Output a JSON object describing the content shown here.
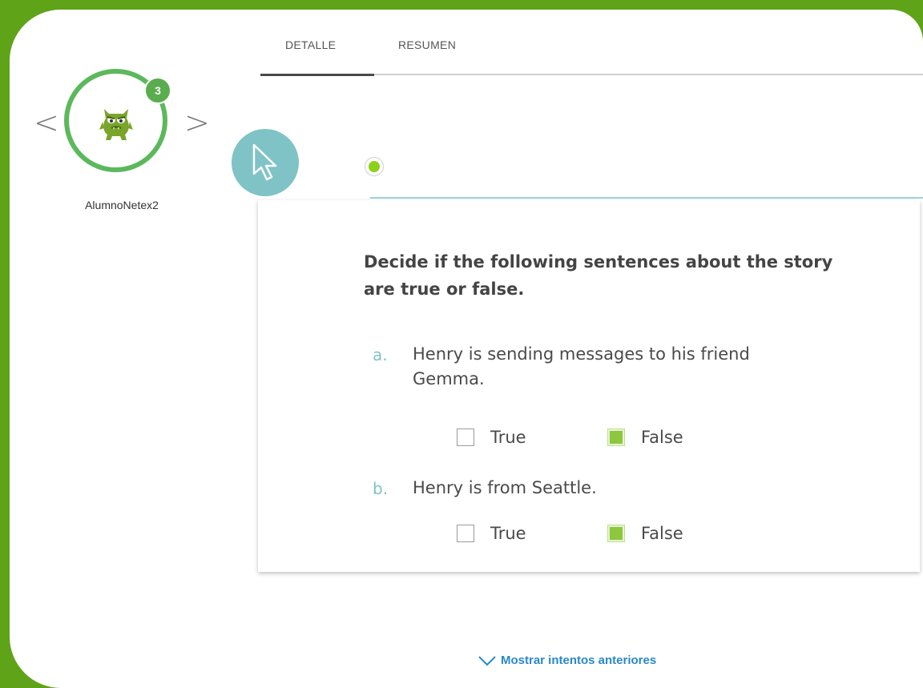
{
  "tabs": [
    {
      "label": "DETALLE",
      "active": true
    },
    {
      "label": "RESUMEN",
      "active": false
    }
  ],
  "student": {
    "name": "AlumnoNetex2",
    "attempt_badge": "3",
    "prev_icon": "chevron-left-icon",
    "next_icon": "chevron-right-icon",
    "avatar_icon": "monster-avatar-icon"
  },
  "activity": {
    "instruction": "Decide if the following sentences about the story are true or false.",
    "questions": [
      {
        "letter": "a.",
        "text": "Henry is sending messages to his friend Gemma.",
        "options": [
          {
            "label": "True",
            "checked": false
          },
          {
            "label": "False",
            "checked": true
          }
        ]
      },
      {
        "letter": "b.",
        "text": "Henry is from Seattle.",
        "options": [
          {
            "label": "True",
            "checked": false
          },
          {
            "label": "False",
            "checked": true
          }
        ]
      }
    ]
  },
  "footer": {
    "show_previous_attempts": "Mostrar intentos anteriores"
  },
  "colors": {
    "background": "#5fa319",
    "accent_green": "#8dc63f",
    "teal": "#7fc3c6",
    "link_blue": "#2a88c9"
  }
}
